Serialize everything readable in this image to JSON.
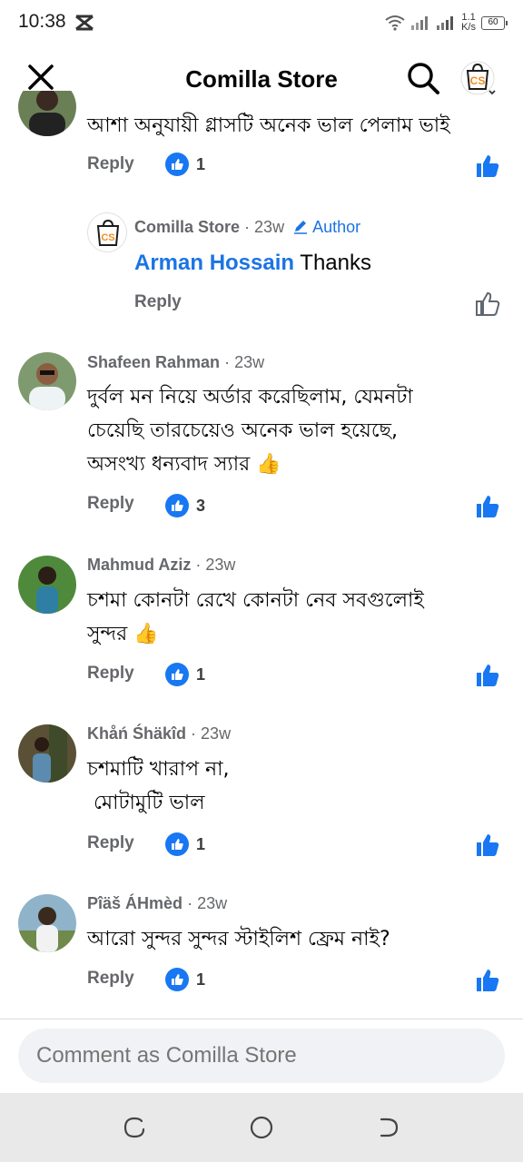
{
  "status_bar": {
    "time": "10:38",
    "speed_value": "1.1",
    "speed_unit": "K/s",
    "battery": "60"
  },
  "header": {
    "title": "Comilla Store"
  },
  "comments": [
    {
      "text": "আশা অনুযায়ী গ্লাসটি অনেক ভাল পেলাম ভাই",
      "reply_label": "Reply",
      "like_count": "1"
    },
    {
      "name": "Comilla Store",
      "time": "23w",
      "author_label": "Author",
      "mention": "Arman Hossain",
      "text": "Thanks",
      "reply_label": "Reply"
    },
    {
      "name": "Shafeen Rahman",
      "time": "23w",
      "text_lines": [
        "দুর্বল মন নিয়ে অর্ডার করেছিলাম, যেমনটা",
        "চেয়েছি তারচেয়েও অনেক ভাল হয়েছে,",
        "অসংখ্য ধন্যবাদ স্যার 👍"
      ],
      "reply_label": "Reply",
      "like_count": "3"
    },
    {
      "name": "Mahmud Aziz",
      "time": "23w",
      "text_lines": [
        "চশমা কোনটা রেখে কোনটা নেব সবগুলোই",
        "সুন্দর 👍"
      ],
      "reply_label": "Reply",
      "like_count": "1"
    },
    {
      "name": "Khåń Śhäkîd",
      "time": "23w",
      "text_lines": [
        "চশমাটি খারাপ না,",
        " মোটামুটি ভাল"
      ],
      "reply_label": "Reply",
      "like_count": "1"
    },
    {
      "name": "Pîäš ÁHmèd",
      "time": "23w",
      "text_lines": [
        "আরো সুন্দর সুন্দর স্টাইলিশ ফ্রেম নাই?"
      ],
      "reply_label": "Reply",
      "like_count": "1"
    }
  ],
  "composer": {
    "placeholder": "Comment as Comilla Store"
  },
  "colors": {
    "accent": "#1877f2",
    "secondary_text": "#65676b",
    "composer_bg": "#f0f2f5",
    "navbar_bg": "#e9e9e9"
  }
}
